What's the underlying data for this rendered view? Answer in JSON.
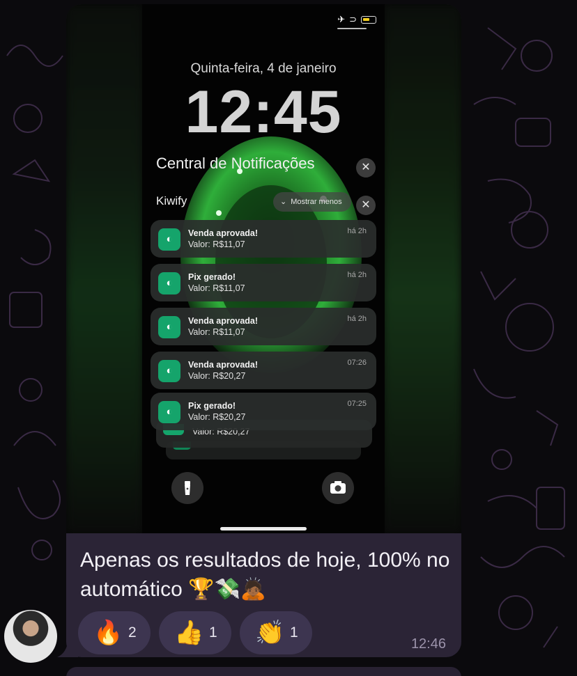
{
  "lockscreen": {
    "date": "Quinta-feira, 4 de janeiro",
    "time": "12:45",
    "status_icons": [
      "airplane-icon",
      "link-icon",
      "battery-icon"
    ],
    "notification_center_title": "Central de Notificações",
    "close_glyph": "✕",
    "app_group": "Kiwify",
    "show_less_label": "Mostrar menos",
    "notifications": [
      {
        "title": "Venda aprovada!",
        "body": "Valor: R$11,07",
        "time": "há 2h"
      },
      {
        "title": "Pix gerado!",
        "body": "Valor: R$11,07",
        "time": "há 2h"
      },
      {
        "title": "Venda aprovada!",
        "body": "Valor: R$11,07",
        "time": "há 2h"
      },
      {
        "title": "Venda aprovada!",
        "body": "Valor: R$20,27",
        "time": "07:26"
      },
      {
        "title": "Pix gerado!",
        "body": "Valor: R$20,27",
        "time": "07:25"
      }
    ],
    "stacked_notification_body": "Valor: R$20,27",
    "icons": {
      "app": "kiwify-icon",
      "flashlight": "flashlight-icon",
      "camera": "camera-icon"
    }
  },
  "message": {
    "caption": "Apenas os resultados de hoje, 100% no automático",
    "caption_emojis": "🏆💸🙇🏾",
    "reactions": [
      {
        "emoji": "🔥",
        "count": "2"
      },
      {
        "emoji": "👍",
        "count": "1"
      },
      {
        "emoji": "👏",
        "count": "1"
      }
    ],
    "timestamp": "12:46"
  },
  "colors": {
    "bubble": "#2b2436",
    "reaction_bg": "#3d3550",
    "kiwify_green": "#15a46b",
    "background": "#0b0a0d"
  }
}
